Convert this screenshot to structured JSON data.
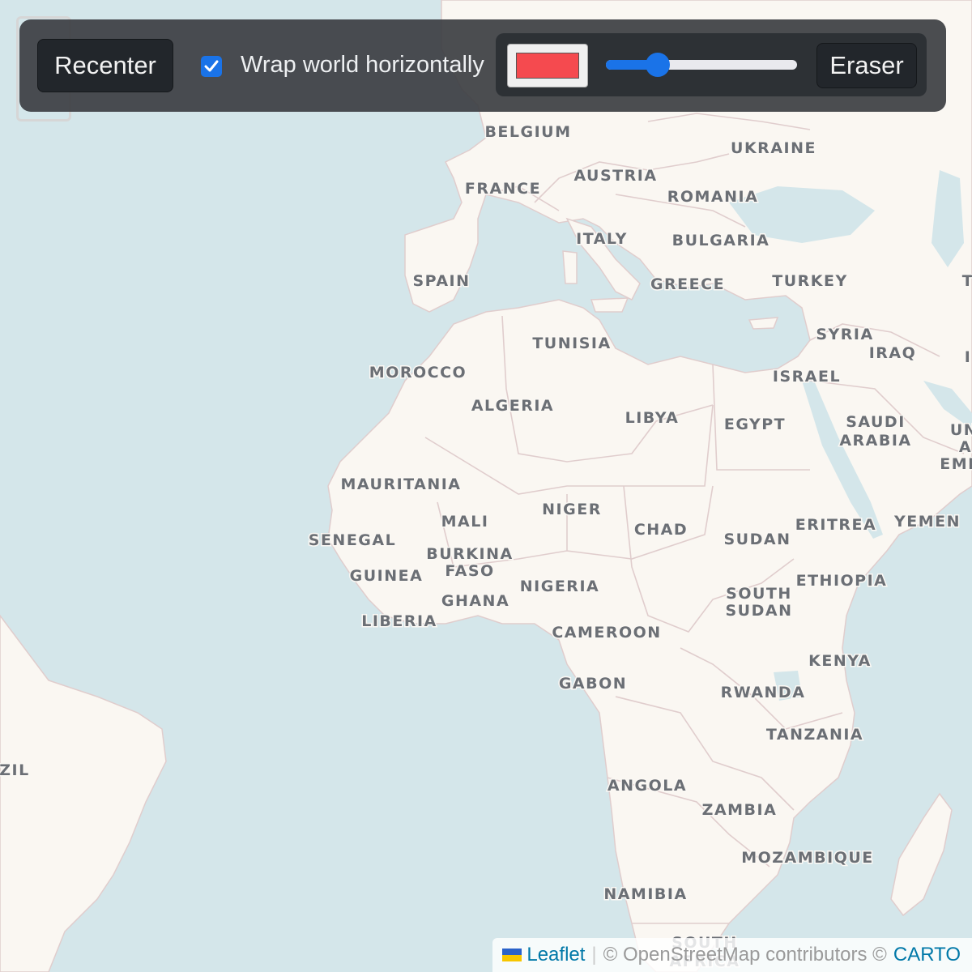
{
  "colors": {
    "water": "#d4e6ea",
    "land": "#faf7f2",
    "border": "#e0cdcd",
    "accent": "#1a73e8",
    "brush": "#f54a4f",
    "flag_blue": "#2a62c9",
    "flag_yellow": "#f7c600"
  },
  "toolbar": {
    "recenter_label": "Recenter",
    "wrap_checked": true,
    "wrap_label": "Wrap world horizontally",
    "brush_color": "#f54a4f",
    "brush_size_fraction": 0.27,
    "eraser_label": "Eraser"
  },
  "map": {
    "labels": [
      "BELGIUM",
      "UKRAINE",
      "FRANCE",
      "AUSTRIA",
      "ROMANIA",
      "ITALY",
      "BULGARIA",
      "SPAIN",
      "GREECE",
      "TURKEY",
      "T",
      "TUNISIA",
      "SYRIA",
      "IRAQ",
      "I",
      "MOROCCO",
      "ISRAEL",
      "ALGERIA",
      "LIBYA",
      "EGYPT",
      "SAUDI",
      "ARABIA",
      "UN",
      "A",
      "EMI",
      "MAURITANIA",
      "NIGER",
      "MALI",
      "ERITREA",
      "YEMEN",
      "CHAD",
      "SENEGAL",
      "SUDAN",
      "BURKINA",
      "FASO",
      "GUINEA",
      "NIGERIA",
      "ETHIOPIA",
      "SOUTH",
      "SUDAN",
      "GHANA",
      "LIBERIA",
      "CAMEROON",
      "KENYA",
      "GABON",
      "RWANDA",
      "TANZANIA",
      "ZIL",
      "ANGOLA",
      "ZAMBIA",
      "MOZAMBIQUE",
      "NAMIBIA",
      "SOUTH",
      "AFRICA"
    ]
  },
  "attribution": {
    "leaflet": "Leaflet",
    "separator": "|",
    "text": "© OpenStreetMap contributors ©",
    "carto": "CARTO"
  }
}
